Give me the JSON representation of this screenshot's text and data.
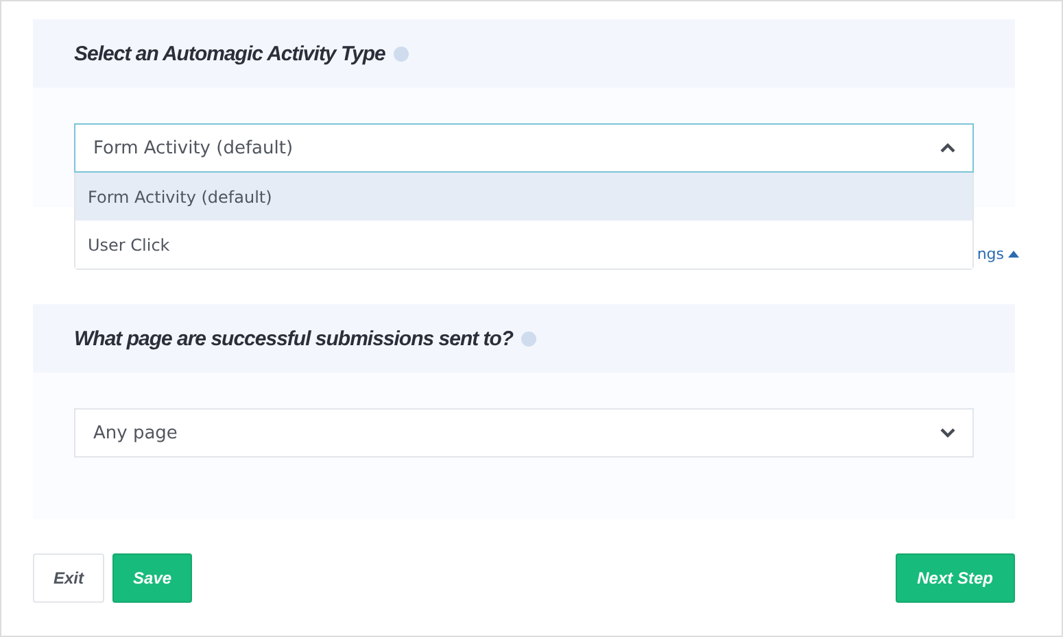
{
  "activity_section": {
    "title": "Select an Automagic Activity Type",
    "select": {
      "value": "Form Activity (default)",
      "expanded": true,
      "options": [
        {
          "label": "Form Activity (default)",
          "selected": true
        },
        {
          "label": "User Click",
          "selected": false
        }
      ]
    }
  },
  "settings_link": {
    "text": "ngs",
    "expanded": true
  },
  "page_section": {
    "title": "What page are successful submissions sent to?",
    "select": {
      "value": "Any page",
      "expanded": false
    }
  },
  "buttons": [
    {
      "label": "Exit",
      "kind": "secondary"
    },
    {
      "label": "Save",
      "kind": "primary"
    },
    {
      "label": "Next Step",
      "kind": "next"
    }
  ]
}
